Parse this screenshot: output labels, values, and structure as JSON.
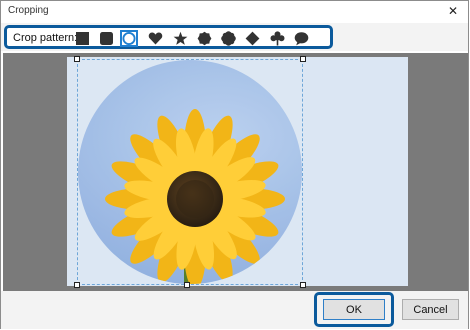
{
  "window": {
    "title": "Cropping",
    "close_glyph": "✕"
  },
  "toolbar": {
    "label": "Crop pattern:",
    "patterns": [
      {
        "icon": "square-icon",
        "selected": false
      },
      {
        "icon": "rounded-square-icon",
        "selected": false
      },
      {
        "icon": "circle-icon",
        "selected": true
      },
      {
        "icon": "heart-icon",
        "selected": false
      },
      {
        "icon": "star-icon",
        "selected": false
      },
      {
        "icon": "octagon-icon",
        "selected": false
      },
      {
        "icon": "flower-icon",
        "selected": false
      },
      {
        "icon": "diamond-icon",
        "selected": false
      },
      {
        "icon": "clover-icon",
        "selected": false
      },
      {
        "icon": "speech-bubble-icon",
        "selected": false
      }
    ],
    "highlight_color": "#0b5a9c"
  },
  "image": {
    "subject": "sunflower-photo",
    "crop_shape": "circle"
  },
  "footer": {
    "ok_label": "OK",
    "cancel_label": "Cancel"
  }
}
